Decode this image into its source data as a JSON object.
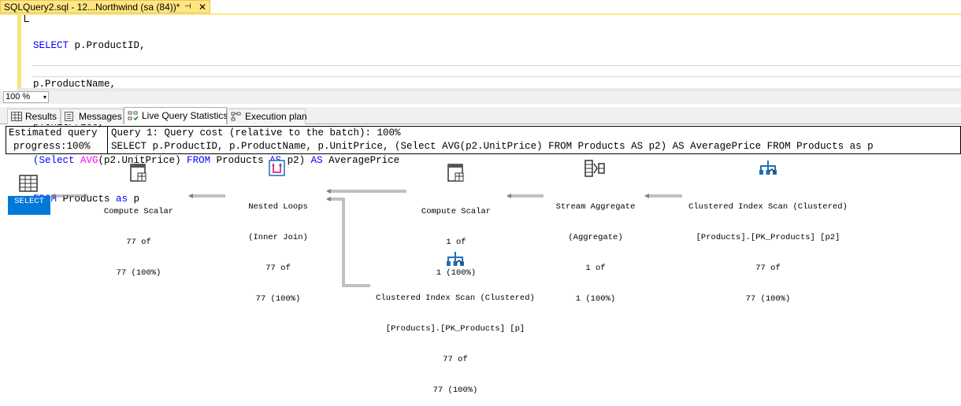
{
  "document_tab": {
    "title": "SQLQuery2.sql - 12...Northwind (sa (84))*",
    "pin_glyph": "⊣",
    "close_glyph": "✕"
  },
  "editor": {
    "lines": [
      [
        "SELECT",
        " p.ProductID,"
      ],
      [
        "",
        "p.ProductName,"
      ],
      [
        "",
        "p.UnitPrice,"
      ],
      [
        "(Select",
        " ",
        "AVG",
        "(p2.UnitPrice) ",
        "FROM",
        " Products ",
        "AS",
        " p2) ",
        "AS",
        " AveragePrice"
      ],
      [
        "FROM",
        " Products ",
        "as",
        " p"
      ]
    ]
  },
  "zoom": {
    "value": "100 %",
    "arrow": "▾"
  },
  "result_tabs": [
    {
      "label": "Results",
      "icon": "grid-icon"
    },
    {
      "label": "Messages",
      "icon": "messages-icon"
    },
    {
      "label": "Live Query Statistics",
      "icon": "live-stats-icon",
      "active": true
    },
    {
      "label": "Execution plan",
      "icon": "execution-plan-icon"
    }
  ],
  "info": {
    "left_line1": "Estimated query",
    "left_line2": "progress:100%",
    "right_line1": "Query 1: Query cost (relative to the batch): 100%",
    "right_line2": "SELECT p.ProductID, p.ProductName, p.UnitPrice, (Select AVG(p2.UnitPrice) FROM Products AS p2) AS AveragePrice FROM Products as p"
  },
  "plan": {
    "select_label": "SELECT",
    "nodes": [
      {
        "id": "compute-scalar-1",
        "icon": "compute-scalar-icon",
        "lines": [
          "Compute Scalar",
          "77 of",
          "77 (100%)"
        ]
      },
      {
        "id": "nested-loops",
        "icon": "nested-loops-icon",
        "lines": [
          "Nested Loops",
          "(Inner Join)",
          "77 of",
          "77 (100%)"
        ]
      },
      {
        "id": "compute-scalar-2",
        "icon": "compute-scalar-icon",
        "lines": [
          "Compute Scalar",
          "1 of",
          "1 (100%)"
        ]
      },
      {
        "id": "stream-aggregate",
        "icon": "stream-aggregate-icon",
        "lines": [
          "Stream Aggregate",
          "(Aggregate)",
          "1 of",
          "1 (100%)"
        ]
      },
      {
        "id": "clustered-index-scan-p2",
        "icon": "clustered-index-scan-icon",
        "lines": [
          "Clustered Index Scan (Clustered)",
          "[Products].[PK_Products] [p2]",
          "77 of",
          "77 (100%)"
        ]
      },
      {
        "id": "clustered-index-scan-p",
        "icon": "clustered-index-scan-icon",
        "lines": [
          "Clustered Index Scan (Clustered)",
          "[Products].[PK_Products] [p]",
          "77 of",
          "77 (100%)"
        ]
      }
    ]
  },
  "colors": {
    "keyword": "#0000ff",
    "function": "#ff00ff",
    "operator": "#808080",
    "tab_accent": "#ffe680",
    "select_highlight": "#0078d7",
    "plan_icon_blue": "#1e6fb8"
  }
}
